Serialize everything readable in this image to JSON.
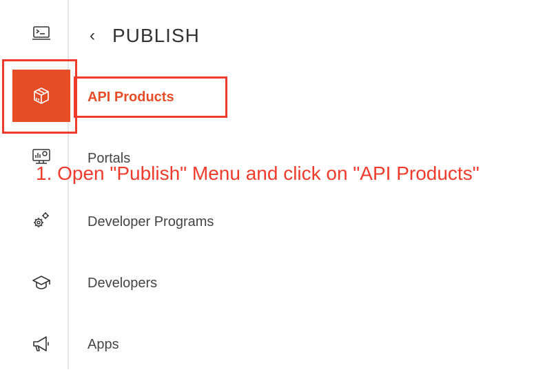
{
  "header": {
    "back_icon": "chevron-left-icon",
    "title": "PUBLISH"
  },
  "rail": {
    "items": [
      {
        "icon": "terminal-icon"
      },
      {
        "icon": "package-icon",
        "active": true
      },
      {
        "icon": "dashboard-monitor-icon"
      },
      {
        "icon": "gears-icon"
      },
      {
        "icon": "graduation-cap-icon"
      },
      {
        "icon": "megaphone-icon"
      }
    ]
  },
  "menu": {
    "items": [
      {
        "label": "API Products",
        "active": true
      },
      {
        "label": "Portals"
      },
      {
        "label": "Developer Programs"
      },
      {
        "label": "Developers"
      },
      {
        "label": "Apps"
      }
    ]
  },
  "annotation": {
    "text": "1. Open \"Publish\" Menu and click on \"API Products\""
  },
  "colors": {
    "accent": "#e44d26",
    "highlight": "#ef3b2c",
    "text": "#444444"
  }
}
